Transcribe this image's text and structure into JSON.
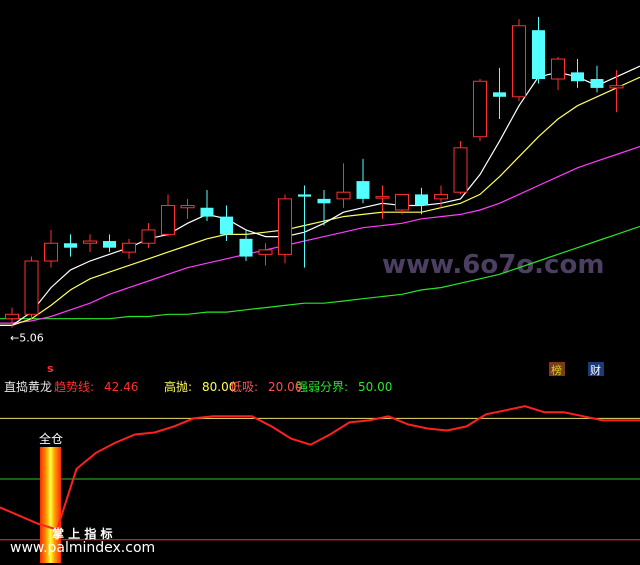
{
  "chart_data": [
    {
      "type": "candlestick",
      "title": "",
      "low_marker_label": "←5.06",
      "signal_marker": "s",
      "badges": [
        {
          "text": "榜",
          "color": "#d2d21e",
          "bg": "#7a3a1c"
        },
        {
          "text": "财",
          "color": "#ffffff",
          "bg": "#1c3a7a"
        }
      ],
      "watermark": "www.6o7o.com",
      "colors": {
        "up": "#ff3030",
        "down": "#54ffff",
        "ma5": "#ffffff",
        "ma10": "#ffff5a",
        "ma20": "#ff3cff",
        "ma60": "#28e628"
      },
      "candles": [
        {
          "o": 5.1,
          "h": 5.15,
          "l": 5.06,
          "c": 5.12
        },
        {
          "o": 5.12,
          "h": 5.38,
          "l": 5.1,
          "c": 5.36
        },
        {
          "o": 5.36,
          "h": 5.5,
          "l": 5.33,
          "c": 5.44
        },
        {
          "o": 5.44,
          "h": 5.48,
          "l": 5.38,
          "c": 5.42
        },
        {
          "o": 5.44,
          "h": 5.48,
          "l": 5.4,
          "c": 5.45
        },
        {
          "o": 5.45,
          "h": 5.48,
          "l": 5.4,
          "c": 5.42
        },
        {
          "o": 5.4,
          "h": 5.46,
          "l": 5.37,
          "c": 5.44
        },
        {
          "o": 5.44,
          "h": 5.53,
          "l": 5.42,
          "c": 5.5
        },
        {
          "o": 5.48,
          "h": 5.66,
          "l": 5.47,
          "c": 5.61
        },
        {
          "o": 5.6,
          "h": 5.64,
          "l": 5.55,
          "c": 5.61
        },
        {
          "o": 5.6,
          "h": 5.68,
          "l": 5.54,
          "c": 5.56
        },
        {
          "o": 5.56,
          "h": 5.61,
          "l": 5.45,
          "c": 5.48
        },
        {
          "o": 5.46,
          "h": 5.5,
          "l": 5.36,
          "c": 5.38
        },
        {
          "o": 5.39,
          "h": 5.44,
          "l": 5.34,
          "c": 5.41
        },
        {
          "o": 5.39,
          "h": 5.66,
          "l": 5.35,
          "c": 5.64
        },
        {
          "o": 5.66,
          "h": 5.7,
          "l": 5.33,
          "c": 5.65
        },
        {
          "o": 5.64,
          "h": 5.68,
          "l": 5.52,
          "c": 5.62
        },
        {
          "o": 5.64,
          "h": 5.8,
          "l": 5.6,
          "c": 5.67
        },
        {
          "o": 5.72,
          "h": 5.82,
          "l": 5.62,
          "c": 5.64
        },
        {
          "o": 5.65,
          "h": 5.7,
          "l": 5.55,
          "c": 5.65
        },
        {
          "o": 5.59,
          "h": 5.66,
          "l": 5.57,
          "c": 5.66
        },
        {
          "o": 5.66,
          "h": 5.69,
          "l": 5.57,
          "c": 5.61
        },
        {
          "o": 5.64,
          "h": 5.7,
          "l": 5.6,
          "c": 5.66
        },
        {
          "o": 5.67,
          "h": 5.9,
          "l": 5.66,
          "c": 5.87
        },
        {
          "o": 5.92,
          "h": 6.18,
          "l": 5.9,
          "c": 6.17
        },
        {
          "o": 6.12,
          "h": 6.23,
          "l": 6.0,
          "c": 6.1
        },
        {
          "o": 6.1,
          "h": 6.45,
          "l": 6.08,
          "c": 6.42
        },
        {
          "o": 6.4,
          "h": 6.46,
          "l": 6.16,
          "c": 6.18
        },
        {
          "o": 6.18,
          "h": 6.28,
          "l": 6.13,
          "c": 6.27
        },
        {
          "o": 6.21,
          "h": 6.27,
          "l": 6.14,
          "c": 6.17
        },
        {
          "o": 6.18,
          "h": 6.24,
          "l": 6.12,
          "c": 6.14
        },
        {
          "o": 6.14,
          "h": 6.22,
          "l": 6.03,
          "c": 6.15
        }
      ],
      "ma": {
        "ma5": [
          5.07,
          5.13,
          5.24,
          5.32,
          5.36,
          5.39,
          5.42,
          5.46,
          5.48,
          5.53,
          5.57,
          5.55,
          5.5,
          5.47,
          5.47,
          5.49,
          5.53,
          5.58,
          5.6,
          5.62,
          5.61,
          5.61,
          5.62,
          5.64,
          5.75,
          5.9,
          6.06,
          6.19,
          6.21,
          6.19,
          6.15,
          6.19
        ],
        "ma10": [
          5.07,
          5.1,
          5.16,
          5.23,
          5.28,
          5.31,
          5.34,
          5.37,
          5.4,
          5.43,
          5.46,
          5.48,
          5.48,
          5.49,
          5.5,
          5.52,
          5.54,
          5.56,
          5.57,
          5.58,
          5.58,
          5.58,
          5.6,
          5.62,
          5.66,
          5.74,
          5.83,
          5.92,
          6.0,
          6.06,
          6.1,
          6.14
        ],
        "ma20": [
          5.08,
          5.09,
          5.11,
          5.14,
          5.17,
          5.21,
          5.24,
          5.27,
          5.3,
          5.33,
          5.35,
          5.37,
          5.39,
          5.41,
          5.43,
          5.45,
          5.47,
          5.49,
          5.51,
          5.52,
          5.53,
          5.55,
          5.56,
          5.57,
          5.59,
          5.62,
          5.66,
          5.7,
          5.74,
          5.78,
          5.81,
          5.84
        ],
        "ma60": [
          5.1,
          5.1,
          5.1,
          5.1,
          5.1,
          5.1,
          5.11,
          5.11,
          5.12,
          5.12,
          5.13,
          5.13,
          5.14,
          5.15,
          5.16,
          5.17,
          5.17,
          5.18,
          5.19,
          5.2,
          5.21,
          5.23,
          5.24,
          5.26,
          5.28,
          5.3,
          5.33,
          5.36,
          5.39,
          5.42,
          5.45,
          5.48
        ]
      },
      "ylim": [
        4.95,
        6.5
      ]
    },
    {
      "type": "line",
      "indicator_name": "直捣黄龙",
      "legend": [
        {
          "label": "趋势线:",
          "value": "42.46",
          "color": "#ff3030"
        },
        {
          "label": "高抛:",
          "value": "80.00",
          "color": "#ffff5a"
        },
        {
          "label": "低吸:",
          "value": "20.00",
          "color": "#ff5050"
        },
        {
          "label": "强弱分界:",
          "value": "50.00",
          "color": "#28e628"
        }
      ],
      "levels": [
        80,
        50,
        20
      ],
      "full_position_label": "全仓",
      "bottom_text": "掌 上 指 标",
      "footer_url": "www.palmindex.com",
      "trend": [
        36,
        28,
        25,
        55,
        63,
        68,
        72,
        73,
        76,
        80,
        81,
        81,
        81,
        76,
        70,
        67,
        72,
        78,
        79,
        81,
        77,
        75,
        74,
        76,
        82,
        84,
        86,
        83,
        83,
        81,
        79,
        79
      ],
      "ylim": [
        10,
        95
      ]
    }
  ]
}
